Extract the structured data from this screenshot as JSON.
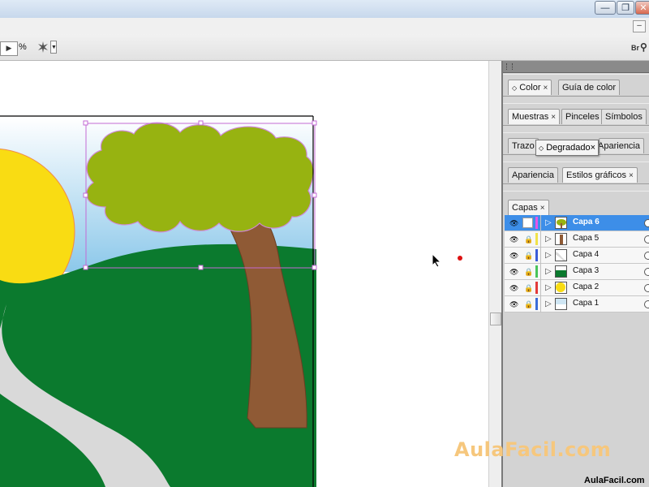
{
  "window": {
    "buttons": {
      "minimize": "—",
      "restore": "❐",
      "close": "✕"
    },
    "mdi_minimize": "–"
  },
  "toolbar": {
    "zoom_arrow": "▶",
    "zoom_unit": "%",
    "tool_dropdown": "▼",
    "bridge_label": "Br"
  },
  "panels": {
    "color_group": {
      "tabs": [
        {
          "label": "Color",
          "close": "×"
        },
        {
          "label": "Guía de color"
        }
      ]
    },
    "swatch_group": {
      "tabs": [
        {
          "label": "Muestras",
          "close": "×"
        },
        {
          "label": "Pinceles"
        },
        {
          "label": "Símbolos"
        }
      ]
    },
    "stroke_group": {
      "tabs": [
        {
          "label": "Trazo"
        },
        {
          "label": "Degradado",
          "close": "×"
        },
        {
          "label": "Apariencia"
        }
      ]
    },
    "appearance_group": {
      "tabs": [
        {
          "label": "Apariencia"
        },
        {
          "label": "Estilos gráficos",
          "close": "×"
        }
      ]
    },
    "layers": {
      "tab": {
        "label": "Capas",
        "close": "×"
      },
      "rows": [
        {
          "name": "Capa 6",
          "color": "#e455e8",
          "selected": true,
          "locked": false
        },
        {
          "name": "Capa 5",
          "color": "#f0e24a",
          "selected": false,
          "locked": true
        },
        {
          "name": "Capa 4",
          "color": "#3a5cd8",
          "selected": false,
          "locked": true
        },
        {
          "name": "Capa 3",
          "color": "#49c45a",
          "selected": false,
          "locked": true
        },
        {
          "name": "Capa 2",
          "color": "#e23a3a",
          "selected": false,
          "locked": true
        },
        {
          "name": "Capa 1",
          "color": "#3a6cd8",
          "selected": false,
          "locked": true
        }
      ]
    }
  },
  "icons": {
    "visibility": "eye-icon",
    "lock": "lock-icon",
    "expand": "triangle-right-icon",
    "target": "target-circle-icon"
  },
  "artwork": {
    "colors": {
      "sky": "#8cc8ea",
      "sun": "#f9dc13",
      "grass": "#0b7a2e",
      "road": "#d9d9d9",
      "trunk": "#8f5a35",
      "foliage": "#97b311",
      "selection": "#c36ad4"
    }
  },
  "watermark": "AulaFacil.com",
  "site_label": "AulaFacil.com"
}
